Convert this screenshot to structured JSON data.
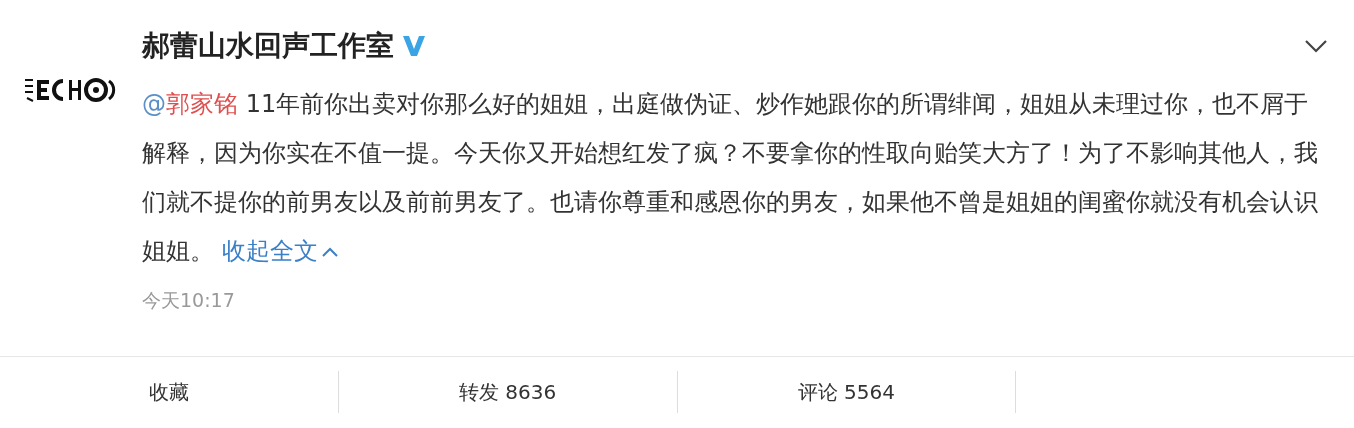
{
  "post": {
    "author": "郝蕾山水回声工作室",
    "verified": true,
    "mention": "@郭家铭",
    "text": " 11年前你出卖对你那么好的姐姐，出庭做伪证、炒作她跟你的所谓绯闻，姐姐从未理过你，也不屑于解释，因为你实在不值一提。今天你又开始想红发了疯？不要拿你的性取向贻笑大方了！为了不影响其他人，我们就不提你的前男友以及前前男友了。也请你尊重和感恩你的男友，如果他不曾是姐姐的闺蜜你就没有机会认识姐姐。",
    "collapse_link": "收起全文",
    "time": "今天10:17"
  },
  "actions": [
    {
      "label": "收藏"
    },
    {
      "label": "转发 8636"
    },
    {
      "label": "评论 5564"
    }
  ]
}
